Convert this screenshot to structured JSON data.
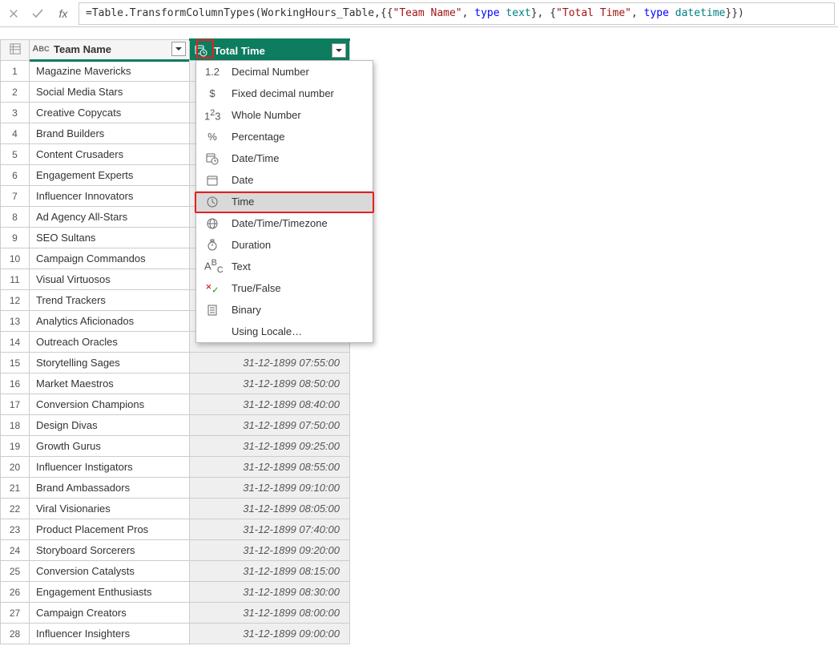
{
  "formula": {
    "prefix": "= ",
    "fn": "Table.TransformColumnTypes",
    "id": "WorkingHours_Table",
    "col1": "\"Team Name\"",
    "kw1": "type",
    "tp1": "text",
    "col2": "\"Total Time\"",
    "kw2": "type",
    "tp2": "datetime"
  },
  "columns": {
    "team": {
      "label": "Team Name",
      "type_icon": "abc-icon"
    },
    "time": {
      "label": "Total Time",
      "type_icon": "datetime-icon"
    }
  },
  "type_menu": {
    "items": [
      {
        "icon": "1.2",
        "label": "Decimal Number"
      },
      {
        "icon": "$",
        "label": "Fixed decimal number"
      },
      {
        "icon": "1²3",
        "label": "Whole Number"
      },
      {
        "icon": "%",
        "label": "Percentage"
      },
      {
        "icon": "cal-clock",
        "label": "Date/Time"
      },
      {
        "icon": "cal",
        "label": "Date"
      },
      {
        "icon": "clock",
        "label": "Time"
      },
      {
        "icon": "globe",
        "label": "Date/Time/Timezone"
      },
      {
        "icon": "stopwatch",
        "label": "Duration"
      },
      {
        "icon": "abc",
        "label": "Text"
      },
      {
        "icon": "xy",
        "label": "True/False"
      },
      {
        "icon": "binary",
        "label": "Binary"
      },
      {
        "icon": "",
        "label": "Using Locale…"
      }
    ],
    "highlight_index": 6
  },
  "rows": [
    {
      "n": 1,
      "team": "Magazine Mavericks",
      "time": ""
    },
    {
      "n": 2,
      "team": "Social Media Stars",
      "time": ""
    },
    {
      "n": 3,
      "team": "Creative Copycats",
      "time": ""
    },
    {
      "n": 4,
      "team": "Brand Builders",
      "time": ""
    },
    {
      "n": 5,
      "team": "Content Crusaders",
      "time": ""
    },
    {
      "n": 6,
      "team": "Engagement Experts",
      "time": ""
    },
    {
      "n": 7,
      "team": "Influencer Innovators",
      "time": ""
    },
    {
      "n": 8,
      "team": "Ad Agency All-Stars",
      "time": ""
    },
    {
      "n": 9,
      "team": "SEO Sultans",
      "time": ""
    },
    {
      "n": 10,
      "team": "Campaign Commandos",
      "time": ""
    },
    {
      "n": 11,
      "team": "Visual Virtuosos",
      "time": ""
    },
    {
      "n": 12,
      "team": "Trend Trackers",
      "time": ""
    },
    {
      "n": 13,
      "team": "Analytics Aficionados",
      "time": ""
    },
    {
      "n": 14,
      "team": "Outreach Oracles",
      "time": ""
    },
    {
      "n": 15,
      "team": "Storytelling Sages",
      "time": "31-12-1899 07:55:00"
    },
    {
      "n": 16,
      "team": "Market Maestros",
      "time": "31-12-1899 08:50:00"
    },
    {
      "n": 17,
      "team": "Conversion Champions",
      "time": "31-12-1899 08:40:00"
    },
    {
      "n": 18,
      "team": "Design Divas",
      "time": "31-12-1899 07:50:00"
    },
    {
      "n": 19,
      "team": "Growth Gurus",
      "time": "31-12-1899 09:25:00"
    },
    {
      "n": 20,
      "team": "Influencer Instigators",
      "time": "31-12-1899 08:55:00"
    },
    {
      "n": 21,
      "team": "Brand Ambassadors",
      "time": "31-12-1899 09:10:00"
    },
    {
      "n": 22,
      "team": "Viral Visionaries",
      "time": "31-12-1899 08:05:00"
    },
    {
      "n": 23,
      "team": "Product Placement Pros",
      "time": "31-12-1899 07:40:00"
    },
    {
      "n": 24,
      "team": "Storyboard Sorcerers",
      "time": "31-12-1899 09:20:00"
    },
    {
      "n": 25,
      "team": "Conversion Catalysts",
      "time": "31-12-1899 08:15:00"
    },
    {
      "n": 26,
      "team": "Engagement Enthusiasts",
      "time": "31-12-1899 08:30:00"
    },
    {
      "n": 27,
      "team": "Campaign Creators",
      "time": "31-12-1899 08:00:00"
    },
    {
      "n": 28,
      "team": "Influencer Insighters",
      "time": "31-12-1899 09:00:00"
    }
  ]
}
